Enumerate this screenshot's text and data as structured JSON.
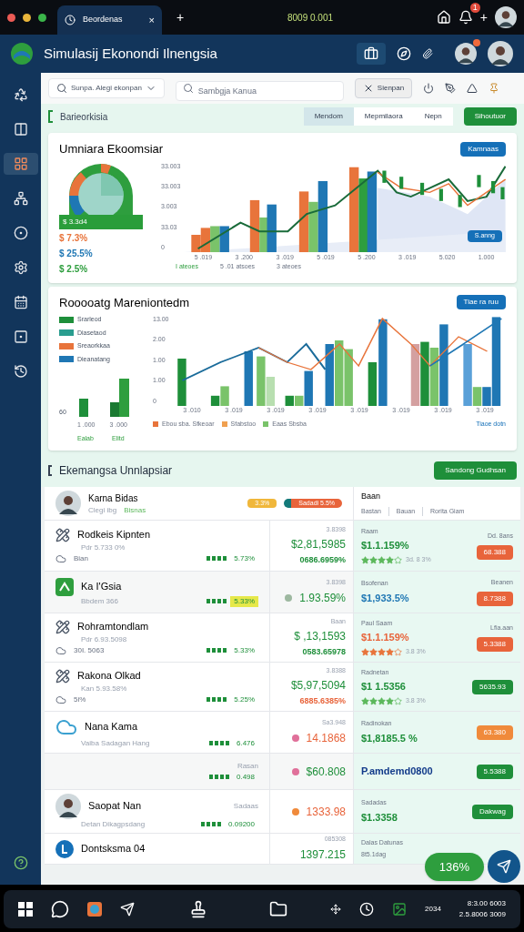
{
  "browser": {
    "tab": {
      "title": "Beordenas",
      "close": "×"
    },
    "new_tab": "+",
    "address": "8009 0.001",
    "add": "+",
    "notification_count": "1"
  },
  "app": {
    "title": "Simulasij Ekonondi Ilnengsia",
    "notification": true
  },
  "sidebar": {
    "items": [
      {
        "selected": false
      },
      {
        "selected": false
      },
      {
        "selected": true
      },
      {
        "selected": false
      },
      {
        "selected": false
      },
      {
        "selected": false
      },
      {
        "selected": false
      },
      {
        "selected": false
      },
      {
        "selected": false
      }
    ]
  },
  "toolbar": {
    "filter": {
      "value": "Sunpa. Alegi ekonpan"
    },
    "search": {
      "placeholder": "Sambgja Kanua"
    },
    "action": "Sienpan"
  },
  "section": {
    "title": "Barieorkisia",
    "tabs": [
      {
        "label": "Mendom",
        "selected": true
      },
      {
        "label": "Mepmilaora",
        "selected": false
      },
      {
        "label": "Nepn",
        "selected": false
      }
    ],
    "button": "Sihoutuor"
  },
  "cards": [
    {
      "kind": "donut",
      "title": "Umniara Ekoomsiar",
      "button": "Kamnaas",
      "donut_label": "$ 3.3d4",
      "legend": [
        {
          "text": "$ 7.3%",
          "color": "#e8743b"
        },
        {
          "text": "$ 25.5%",
          "color": "#1f77b4"
        },
        {
          "text": "$ 2.5%",
          "color": "#2e9e3e"
        }
      ],
      "yticks": [
        "33.003",
        "33.003",
        "3.003",
        "33.03",
        "0"
      ],
      "xticks": [
        "5 .019",
        "3 .200",
        "3 .019",
        "5 .019",
        "5 .200",
        "3 .019",
        "5.020",
        "1.000"
      ],
      "overlay_button": "S.anng",
      "footer": [
        "I ateoes",
        "5 .01 atsoes",
        "3 ateoes"
      ]
    },
    {
      "kind": "bars",
      "title": "Rooooatg Mareniontedm",
      "button": "Tiae ra ruu",
      "legend": [
        {
          "text": "Srarleod",
          "color": "#1e8f3a"
        },
        {
          "text": "Diasetaod",
          "color": "#2a9d8f"
        },
        {
          "text": "Sreaorkkaa",
          "color": "#e8743b"
        },
        {
          "text": "Dieanatang",
          "color": "#1f77b4"
        }
      ],
      "yticks": [
        "13.00",
        "2.00",
        "1.00",
        "1.00",
        "0"
      ],
      "xticks": [
        "3 .010",
        "3 .019",
        "3 .019",
        "3 .019",
        "3 .019",
        "3 .019",
        "3 .019",
        "3 .019"
      ],
      "mini_axis": "60",
      "mini_xticks": [
        "1 .000",
        "3 .000"
      ],
      "mini_footer": [
        "Ealab",
        "Elitd"
      ],
      "footer": [
        {
          "text": "Ebou sba. Sfkeoar",
          "color": "#e8743b"
        },
        {
          "text": "Sfabstoo",
          "color": "#f0a050"
        },
        {
          "text": "Eaas Sbsba",
          "color": "#7ac36a"
        }
      ],
      "footer_link": "Tiaoe dotn"
    }
  ],
  "table": {
    "title": "Ekemangsa Unnlapsiar",
    "button": "Sandong Gudhsan",
    "profile": {
      "name": "Karna Bidas",
      "subtitle": "Clegi ibg",
      "tag": "Bisnas",
      "badge": "3.3%",
      "status": "Sadadi 5.5%",
      "column_title": "Baan",
      "columns": [
        "Bastan",
        "Bauan",
        "Rorita Giam"
      ]
    },
    "rows": [
      {
        "kind": "sketch",
        "name": "Rodkeis Kipnten",
        "sub": "Pdr 5.733 0%",
        "meta": "Bian",
        "indicator": "5.73%",
        "indicator_highlight": false,
        "label2": "3.8398",
        "amount": {
          "text": "$2,81,5985",
          "color": "#1e8f3a"
        },
        "sub_amount": {
          "text": "0686.6959%",
          "color": "#1e8f3a"
        },
        "label3": "Raam",
        "amount3": {
          "text": "$1.1.159%",
          "color": "#1e8f3a"
        },
        "rating": {
          "stars": 4,
          "color": "#5cb85c",
          "text": "3d. 8 3%"
        },
        "badge_label": "Dd. 8ans",
        "badge": {
          "text": "68.388",
          "color": "#e8643b"
        }
      },
      {
        "kind": "app",
        "name": "Ka I'Gsia",
        "sub": "Bbdem 366",
        "indicator": "5.33%",
        "indicator_highlight": true,
        "label2": "3.8398",
        "dot": {
          "color": "#9db8a0"
        },
        "amount": {
          "text": "1.93.59%",
          "color": "#1e8f3a"
        },
        "label3": "Bsofenan",
        "amount3": {
          "text": "$1,933.5%",
          "color": "#1f77b4"
        },
        "badge_label": "Beanen",
        "badge": {
          "text": "8.7388",
          "color": "#e8643b"
        }
      },
      {
        "kind": "sketch",
        "name": "Rohramtondlam",
        "sub": "Pdr 6.93.5098",
        "meta": "30I. 5063",
        "indicator": "5.33%",
        "indicator_highlight": false,
        "label2": "Baan",
        "amount": {
          "text": "$ ,13,1593",
          "color": "#1e8f3a"
        },
        "sub_amount": {
          "text": "0583.65978",
          "color": "#1e8f3a"
        },
        "label3": "Paul Saam",
        "amount3": {
          "text": "$1.1.159%",
          "color": "#e8643b"
        },
        "rating": {
          "stars": 4,
          "color": "#e8743b",
          "text": "3.8 3%"
        },
        "badge_label": "Lfia.aan",
        "badge": {
          "text": "5.3388",
          "color": "#e8643b"
        }
      },
      {
        "kind": "sketch",
        "name": "Rakona Olkad",
        "sub": "Kan 5.93.58%",
        "meta": "5i%",
        "indicator": "5.25%",
        "indicator_highlight": false,
        "label2": "3.8388",
        "amount": {
          "text": "$5,97,5094",
          "color": "#1e8f3a"
        },
        "sub_amount": {
          "text": "6885.6385%",
          "color": "#e8643b"
        },
        "label3": "Radnetan",
        "amount3": {
          "text": "$1 1.5356",
          "color": "#1e8f3a"
        },
        "rating": {
          "stars": 4,
          "color": "#5cb85c",
          "text": "3.8 3%"
        },
        "badge": {
          "text": "5635.93",
          "color": "#1e8f3a"
        }
      },
      {
        "kind": "cloud",
        "name": "Nana Kama",
        "sub": "Vaiba Sadagan Hang",
        "indicator": "6.476",
        "indicator_highlight": false,
        "label2": "Sa3.948",
        "dot": {
          "color": "#e0709a"
        },
        "amount": {
          "text": "14.1868",
          "color": "#e8643b"
        },
        "label3": "Radinokan",
        "amount3": {
          "text": "$1,8185.5 %",
          "color": "#1e8f3a"
        },
        "badge": {
          "text": "63.380",
          "color": "#f08a3b"
        }
      },
      {
        "kind": "summary",
        "indicator_label": "Rasan",
        "indicator": "0.498",
        "indicator_highlight": false,
        "dot": {
          "color": "#e0709a"
        },
        "amount": {
          "text": "$60.808",
          "color": "#1e8f3a"
        },
        "amount3": {
          "text": "P.amdemd0800",
          "color": "#123a8a"
        },
        "badge": {
          "text": "5.5388",
          "color": "#1e8f3a"
        }
      },
      {
        "kind": "avatar",
        "name": "Saopat Nan",
        "sub": "Detan Dikagpsdang",
        "indicator_label": "Sadaas",
        "indicator": "0.09200",
        "indicator_highlight": false,
        "dot": {
          "color": "#f08a3b"
        },
        "amount": {
          "text": "1333.98",
          "color": "#e8643b"
        },
        "label3": "Sadadas",
        "amount3": {
          "text": "$1.3358",
          "color": "#1e8f3a"
        },
        "badge": {
          "text": "Dakwag",
          "color": "#1e8f3a"
        }
      },
      {
        "kind": "circle",
        "name": "Dontsksma 04",
        "label2": "085308",
        "amount": {
          "text": "1397.215",
          "color": "#1e8f3a"
        },
        "label3": "Dalas Datunas",
        "badge_label": "8t5.1dag"
      }
    ]
  },
  "fab": {
    "label": "136%"
  },
  "taskbar": {
    "tray_text": "2034",
    "time": "8:3.00 6003",
    "date": "2.5.8006 3009"
  }
}
